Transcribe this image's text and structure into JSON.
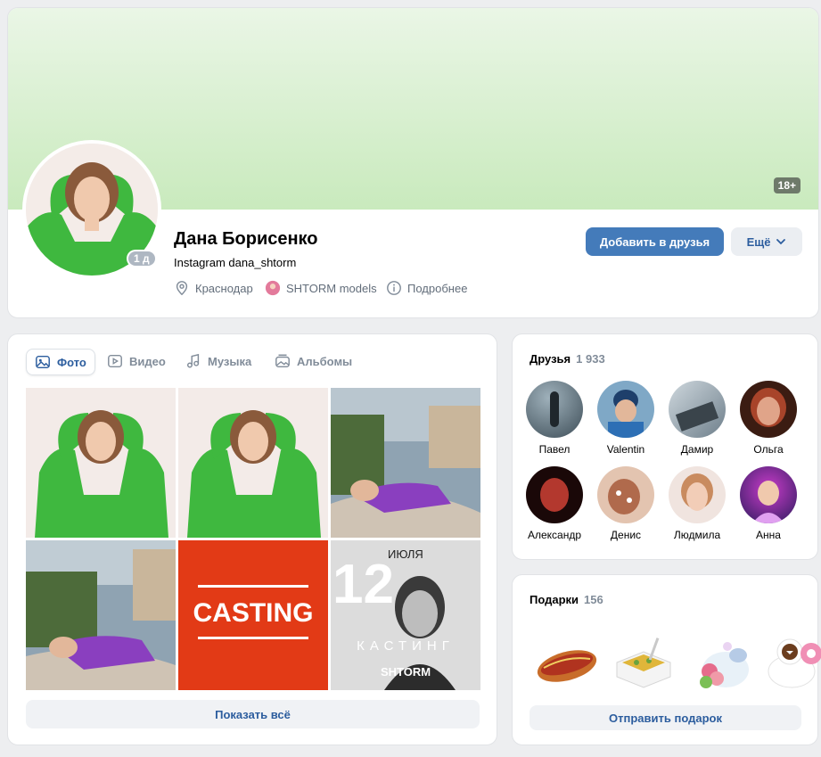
{
  "profile": {
    "age_badge": "18+",
    "online": "1 д",
    "name": "Дана Борисенко",
    "status": "Instagram dana_shtorm",
    "city": "Краснодар",
    "work": "SHTORM models",
    "details": "Подробнее",
    "add_friend": "Добавить в друзья",
    "more": "Ещё"
  },
  "media": {
    "tabs": [
      "Фото",
      "Видео",
      "Музыка",
      "Альбомы"
    ],
    "casting_label": "CASTING",
    "poster": {
      "day": "12",
      "month": "ИЮЛЯ",
      "word": "КАСТИНГ",
      "brand": "SHTORM"
    },
    "show_all": "Показать всё"
  },
  "friends": {
    "title": "Друзья",
    "count": "1 933",
    "list": [
      "Павел",
      "Valentin",
      "Дамир",
      "Ольга",
      "Александр",
      "Денис",
      "Людмила",
      "Анна"
    ]
  },
  "gifts": {
    "title": "Подарки",
    "count": "156",
    "send": "Отправить подарок"
  },
  "colors": {
    "accent": "#447bba",
    "link": "#2c5d9e",
    "cover": "#c9eabd"
  }
}
